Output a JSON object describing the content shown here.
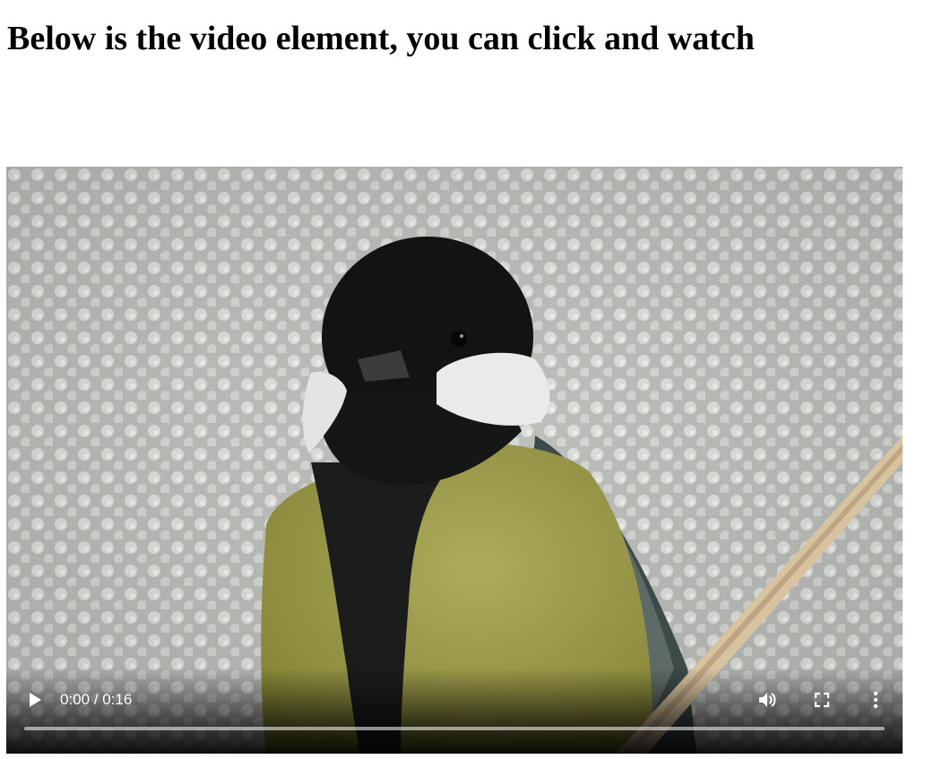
{
  "page": {
    "heading": "Below is the video element, you can click and watch"
  },
  "video": {
    "time_display": "0:00 / 0:16",
    "current_time_seconds": 0,
    "duration_seconds": 16,
    "progress_fraction": 0.0,
    "controls": {
      "play_icon": "play-icon",
      "volume_icon": "volume-icon",
      "fullscreen_icon": "fullscreen-icon",
      "more_icon": "more-options-icon"
    }
  },
  "colors": {
    "heading_text": "#000000",
    "control_icons": "#ffffff",
    "progress_track": "#d9d9d9",
    "page_background": "#ffffff"
  }
}
